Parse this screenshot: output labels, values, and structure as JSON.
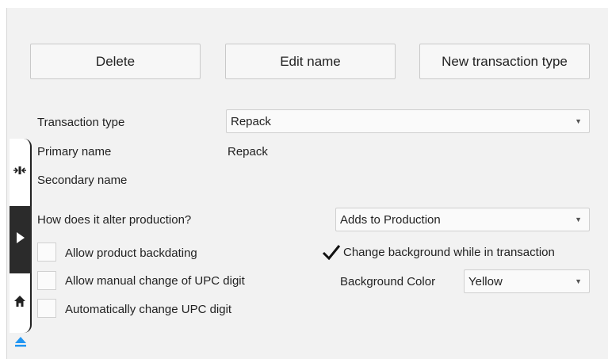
{
  "toolbar": {
    "delete_label": "Delete",
    "edit_name_label": "Edit name",
    "new_type_label": "New transaction type"
  },
  "form": {
    "transaction_type_label": "Transaction type",
    "transaction_type_value": "Repack",
    "primary_name_label": "Primary name",
    "primary_name_value": "Repack",
    "secondary_name_label": "Secondary name",
    "secondary_name_value": "",
    "alter_production_label": "How does it alter production?",
    "alter_production_value": "Adds to Production",
    "allow_backdating_label": "Allow product backdating",
    "allow_backdating_checked": false,
    "allow_manual_upc_label": "Allow manual change of UPC digit",
    "allow_manual_upc_checked": false,
    "auto_change_upc_label": "Automatically change UPC digit",
    "auto_change_upc_checked": false,
    "change_background_label": "Change background while in transaction",
    "change_background_checked": true,
    "background_color_label": "Background Color",
    "background_color_value": "Yellow"
  },
  "icons": {
    "dropdown": "chevron-down-icon",
    "check": "checkmark-icon",
    "sidebar_tabs": [
      "compress-icon",
      "play-arrow-icon",
      "home-icon",
      "eject-icon"
    ]
  },
  "colors": {
    "panel_bg": "#f2f2f2",
    "active_side_tab": "#2b2b2b",
    "accent_blue": "#2196f3"
  }
}
